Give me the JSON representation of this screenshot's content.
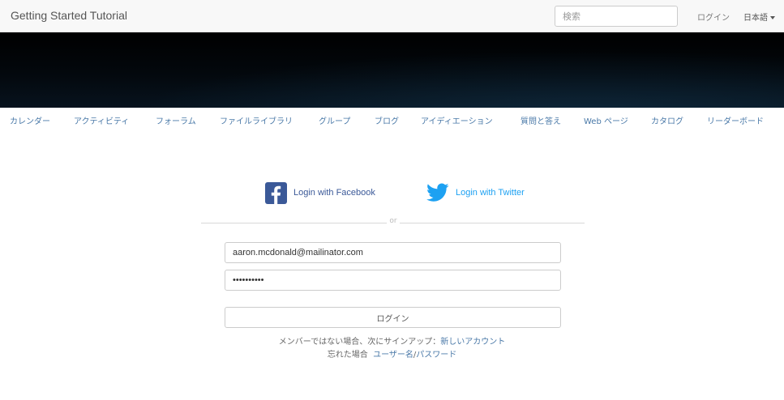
{
  "navbar": {
    "brand": "Getting Started Tutorial",
    "search_placeholder": "検索",
    "login": "ログイン",
    "language": "日本語"
  },
  "categories": [
    {
      "label": "カレンダー"
    },
    {
      "label": "アクティビティ"
    },
    {
      "label": "フォーラム"
    },
    {
      "label": "ファイルライブラリ"
    },
    {
      "label": "グループ"
    },
    {
      "label": "ブログ"
    },
    {
      "label": "アイディエーション"
    },
    {
      "label": "質問と答え"
    },
    {
      "label": "Web ページ"
    },
    {
      "label": "カタログ"
    },
    {
      "label": "リーダーボード"
    }
  ],
  "social": {
    "facebook_label": "Login with Facebook",
    "twitter_label": "Login with Twitter",
    "or": "or"
  },
  "form": {
    "email_value": "aaron.mcdonald@mailinator.com",
    "password_value": "••••••••••",
    "login_button": "ログイン"
  },
  "help": {
    "not_member_text": "メンバーではない場合、次にサインアップ：",
    "new_account_link": "新しいアカウント",
    "forgot_text": "忘れた場合",
    "username_link": "ユーザー名",
    "slash": "/",
    "password_link": "パスワード"
  },
  "colors": {
    "facebook": "#3b5998",
    "twitter": "#1da1f2",
    "link": "#4a79a8"
  }
}
